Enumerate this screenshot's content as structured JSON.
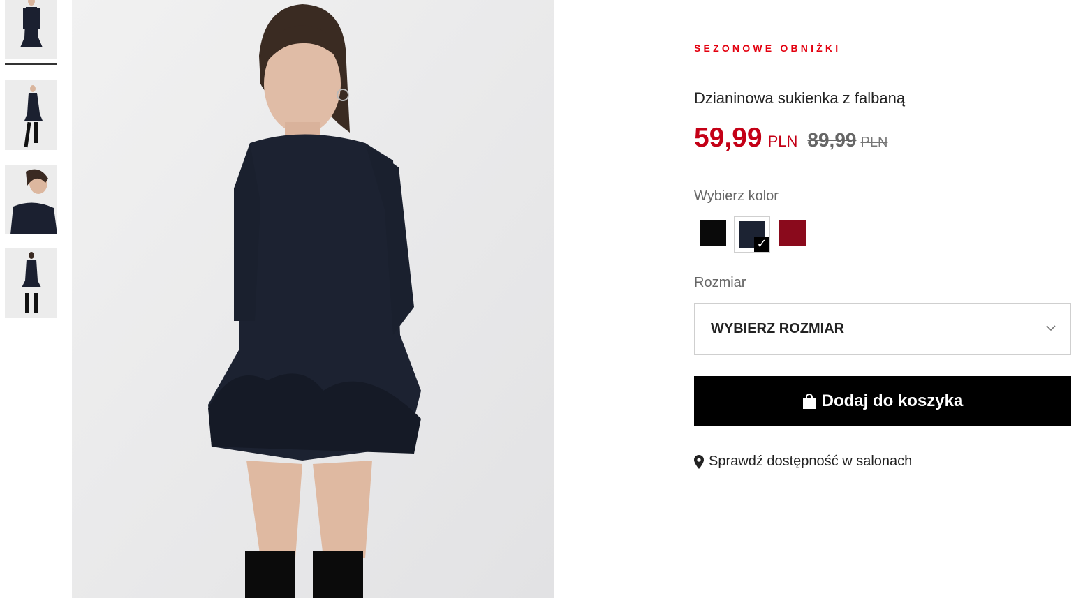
{
  "gallery": {
    "thumbnails": [
      {
        "alt": "front view",
        "active": true
      },
      {
        "alt": "side walking view",
        "active": false
      },
      {
        "alt": "neckline close-up",
        "active": false
      },
      {
        "alt": "back view",
        "active": false
      }
    ]
  },
  "product": {
    "promo_label": "SEZONOWE OBNIŻKI",
    "title": "Dzianinowa sukienka z falbaną",
    "price_now": "59,99",
    "price_now_currency": "PLN",
    "price_old": "89,99",
    "price_old_currency": "PLN"
  },
  "color": {
    "label": "Wybierz kolor",
    "options": [
      {
        "name": "black",
        "hex": "#0a0a0a",
        "selected": false
      },
      {
        "name": "navy",
        "hex": "#1c2333",
        "selected": true
      },
      {
        "name": "burgundy",
        "hex": "#8a0a1c",
        "selected": false
      }
    ]
  },
  "size": {
    "label": "Rozmiar",
    "selected_text": "WYBIERZ ROZMIAR"
  },
  "actions": {
    "add_to_cart": "Dodaj do koszyka",
    "check_availability": "Sprawdź dostępność w salonach"
  },
  "icons": {
    "bag": "shopping-bag-icon",
    "pin": "location-pin-icon",
    "chevron": "chevron-down-icon",
    "check": "checkmark-icon"
  }
}
